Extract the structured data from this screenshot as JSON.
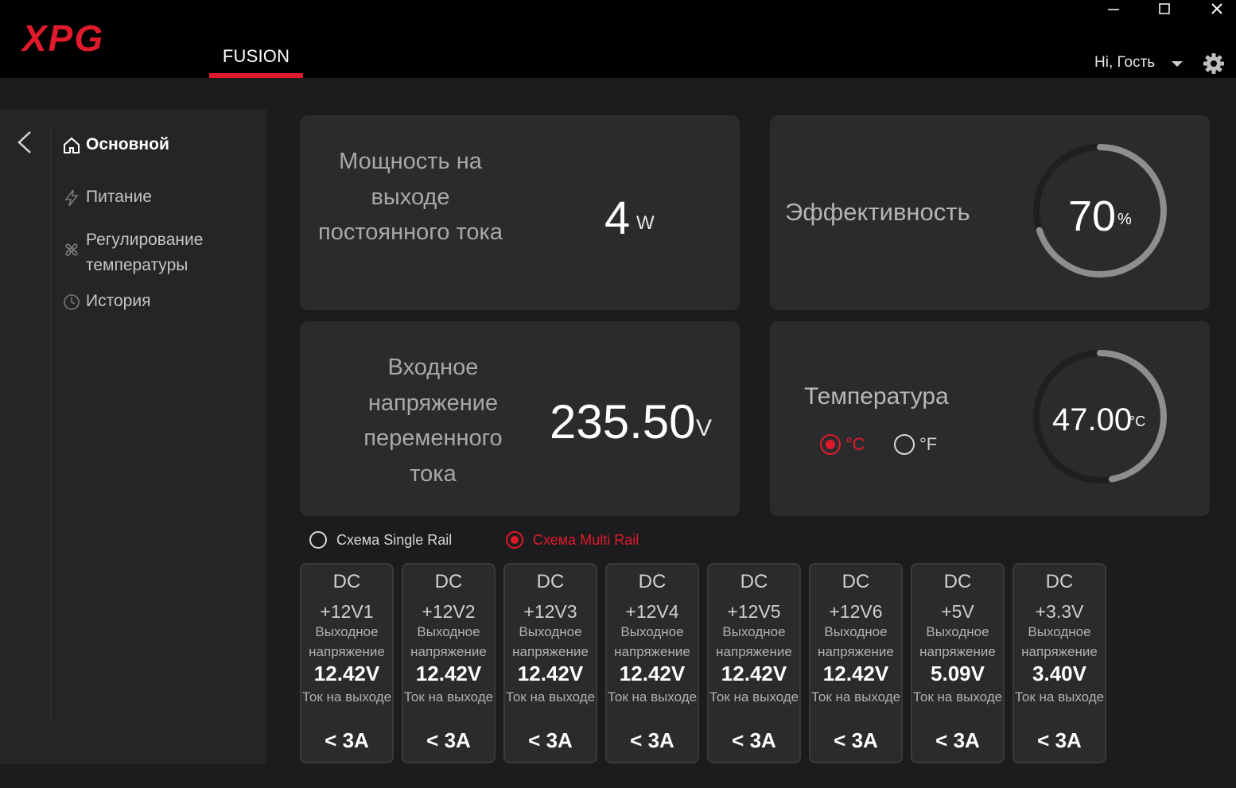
{
  "header": {
    "brand": "XPG",
    "tab": "FUSION",
    "user": "Hi, Гость",
    "accent_color": "#e01a2b"
  },
  "sidebar": {
    "items": [
      {
        "label": "Основной",
        "icon": "home-icon",
        "active": true
      },
      {
        "label": "Питание",
        "icon": "lightning-icon"
      },
      {
        "label": "Регулирование температуры",
        "icon": "fan-icon"
      },
      {
        "label": "История",
        "icon": "clock-icon"
      }
    ]
  },
  "cards": {
    "dc_power": {
      "label": "Мощность на выходе постоянного тока",
      "value": "4",
      "unit": "W"
    },
    "efficiency": {
      "label": "Эффективность",
      "value": "70",
      "unit": "%",
      "fraction": 0.7
    },
    "ac_voltage": {
      "label": "Входное напряжение переменного тока",
      "value": "235.50",
      "unit": "V"
    },
    "temperature": {
      "label": "Температура",
      "value": "47.00",
      "unit": "°C",
      "fraction": 0.47,
      "options": [
        "°C",
        "°F"
      ],
      "selected": "°C"
    }
  },
  "schemes": {
    "single": "Схема Single Rail",
    "multi": "Схема Multi Rail",
    "selected": "multi"
  },
  "rails": [
    {
      "dc": "DC",
      "name": "+12V1",
      "voltage_label": "Выходное напряжение",
      "voltage": "12.42V",
      "current_label": "Ток на выходе",
      "current": "< 3A"
    },
    {
      "dc": "DC",
      "name": "+12V2",
      "voltage_label": "Выходное напряжение",
      "voltage": "12.42V",
      "current_label": "Ток на выходе",
      "current": "< 3A"
    },
    {
      "dc": "DC",
      "name": "+12V3",
      "voltage_label": "Выходное напряжение",
      "voltage": "12.42V",
      "current_label": "Ток на выходе",
      "current": "< 3A"
    },
    {
      "dc": "DC",
      "name": "+12V4",
      "voltage_label": "Выходное напряжение",
      "voltage": "12.42V",
      "current_label": "Ток на выходе",
      "current": "< 3A"
    },
    {
      "dc": "DC",
      "name": "+12V5",
      "voltage_label": "Выходное напряжение",
      "voltage": "12.42V",
      "current_label": "Ток на выходе",
      "current": "< 3A"
    },
    {
      "dc": "DC",
      "name": "+12V6",
      "voltage_label": "Выходное напряжение",
      "voltage": "12.42V",
      "current_label": "Ток на выходе",
      "current": "< 3A"
    },
    {
      "dc": "DC",
      "name": "+5V",
      "voltage_label": "Выходное напряжение",
      "voltage": "5.09V",
      "current_label": "Ток на выходе",
      "current": "< 3A"
    },
    {
      "dc": "DC",
      "name": "+3.3V",
      "voltage_label": "Выходное напряжение",
      "voltage": "3.40V",
      "current_label": "Ток на выходе",
      "current": "< 3A"
    }
  ]
}
